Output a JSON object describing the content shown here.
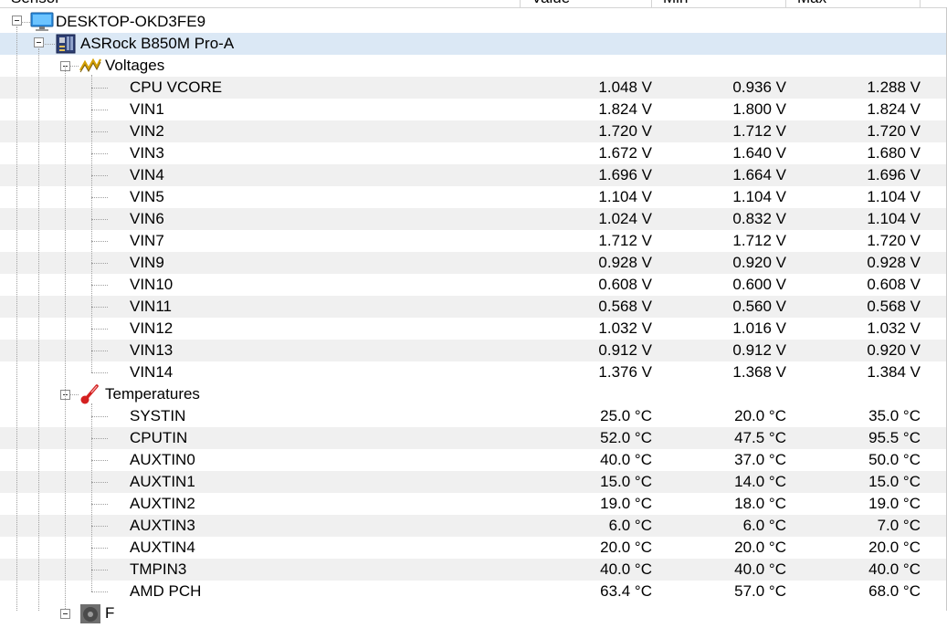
{
  "columns": {
    "sensor": "Sensor",
    "value": "Value",
    "min": "Min",
    "max": "Max"
  },
  "computer": {
    "name": "DESKTOP-OKD3FE9",
    "icon": "monitor-icon"
  },
  "board": {
    "name": "ASRock B850M Pro-A",
    "icon": "motherboard-icon"
  },
  "voltages": {
    "label": "Voltages",
    "icon": "voltage-icon",
    "rows": [
      {
        "name": "CPU VCORE",
        "value": "1.048 V",
        "min": "0.936 V",
        "max": "1.288 V"
      },
      {
        "name": "VIN1",
        "value": "1.824 V",
        "min": "1.800 V",
        "max": "1.824 V"
      },
      {
        "name": "VIN2",
        "value": "1.720 V",
        "min": "1.712 V",
        "max": "1.720 V"
      },
      {
        "name": "VIN3",
        "value": "1.672 V",
        "min": "1.640 V",
        "max": "1.680 V"
      },
      {
        "name": "VIN4",
        "value": "1.696 V",
        "min": "1.664 V",
        "max": "1.696 V"
      },
      {
        "name": "VIN5",
        "value": "1.104 V",
        "min": "1.104 V",
        "max": "1.104 V"
      },
      {
        "name": "VIN6",
        "value": "1.024 V",
        "min": "0.832 V",
        "max": "1.104 V"
      },
      {
        "name": "VIN7",
        "value": "1.712 V",
        "min": "1.712 V",
        "max": "1.720 V"
      },
      {
        "name": "VIN9",
        "value": "0.928 V",
        "min": "0.920 V",
        "max": "0.928 V"
      },
      {
        "name": "VIN10",
        "value": "0.608 V",
        "min": "0.600 V",
        "max": "0.608 V"
      },
      {
        "name": "VIN11",
        "value": "0.568 V",
        "min": "0.560 V",
        "max": "0.568 V"
      },
      {
        "name": "VIN12",
        "value": "1.032 V",
        "min": "1.016 V",
        "max": "1.032 V"
      },
      {
        "name": "VIN13",
        "value": "0.912 V",
        "min": "0.912 V",
        "max": "0.920 V"
      },
      {
        "name": "VIN14",
        "value": "1.376 V",
        "min": "1.368 V",
        "max": "1.384 V"
      }
    ]
  },
  "temperatures": {
    "label": "Temperatures",
    "icon": "thermometer-icon",
    "rows": [
      {
        "name": "SYSTIN",
        "value": "25.0 °C",
        "min": "20.0 °C",
        "max": "35.0 °C"
      },
      {
        "name": "CPUTIN",
        "value": "52.0 °C",
        "min": "47.5 °C",
        "max": "95.5 °C"
      },
      {
        "name": "AUXTIN0",
        "value": "40.0 °C",
        "min": "37.0 °C",
        "max": "50.0 °C"
      },
      {
        "name": "AUXTIN1",
        "value": "15.0 °C",
        "min": "14.0 °C",
        "max": "15.0 °C"
      },
      {
        "name": "AUXTIN2",
        "value": "19.0 °C",
        "min": "18.0 °C",
        "max": "19.0 °C"
      },
      {
        "name": "AUXTIN3",
        "value": "6.0 °C",
        "min": "6.0 °C",
        "max": "7.0 °C"
      },
      {
        "name": "AUXTIN4",
        "value": "20.0 °C",
        "min": "20.0 °C",
        "max": "20.0 °C"
      },
      {
        "name": "TMPIN3",
        "value": "40.0 °C",
        "min": "40.0 °C",
        "max": "40.0 °C"
      },
      {
        "name": "AMD PCH",
        "value": "63.4 °C",
        "min": "57.0 °C",
        "max": "68.0 °C"
      }
    ]
  },
  "fans": {
    "label": "F",
    "icon": "fan-icon"
  }
}
